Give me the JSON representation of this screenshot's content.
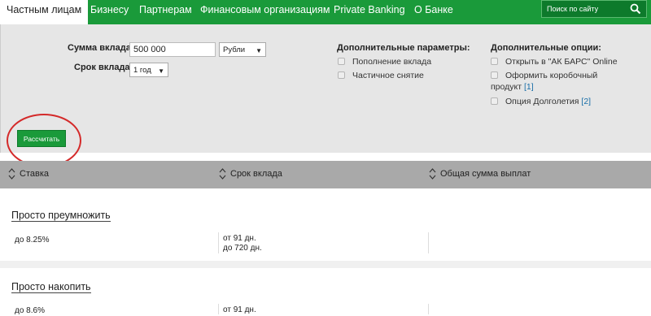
{
  "nav": {
    "items": [
      "Частным лицам",
      "Бизнесу",
      "Партнерам",
      "Финансовым организациям",
      "Private Banking",
      "О Банке"
    ],
    "active": 0,
    "search_placeholder": "Поиск по сайту",
    "search_icon": "search-icon"
  },
  "form": {
    "amount_label": "Сумма вклада",
    "amount_value": "500 000",
    "currency_value": "Рубли",
    "term_label": "Срок вклада",
    "term_value": "1 год"
  },
  "params": {
    "title": "Дополнительные параметры:",
    "items": [
      "Пополнение вклада",
      "Частичное снятие"
    ]
  },
  "options": {
    "title": "Дополнительные опции:",
    "item1": "Открыть в \"АК БАРС\" Online",
    "item2_line1": "Оформить коробочный",
    "item2_line2": "продукт",
    "item2_ref": "[1]",
    "item3": "Опция Долголетия",
    "item3_ref": "[2]"
  },
  "calc_button": "Рассчитать",
  "table": {
    "headers": [
      "Ставка",
      "Срок вклада",
      "Общая сумма выплат"
    ]
  },
  "products": [
    {
      "title": "Просто преумножить",
      "rate": "до 8.25%",
      "term_from": "от 91 дн.",
      "term_to": "до 720 дн."
    },
    {
      "title": "Просто накопить",
      "rate": "до 8.6%",
      "term_from": "от 91 дн."
    }
  ],
  "colors": {
    "brand_green": "#1a9a3a",
    "highlight_red": "#d42a2a",
    "header_gray": "#a9a9a9",
    "panel_gray": "#e6e6e6"
  }
}
